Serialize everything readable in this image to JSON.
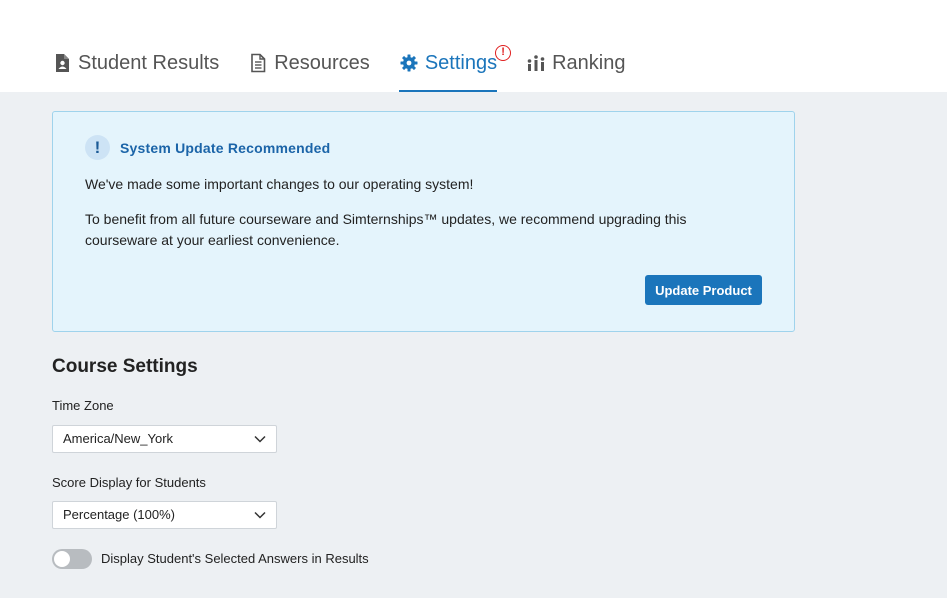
{
  "tabs": [
    {
      "label": "Student Results",
      "icon": "document-person-icon"
    },
    {
      "label": "Resources",
      "icon": "document-lines-icon"
    },
    {
      "label": "Settings",
      "icon": "gear-icon",
      "active": true,
      "badge": "!"
    },
    {
      "label": "Ranking",
      "icon": "ranking-icon"
    }
  ],
  "notice": {
    "icon_text": "!",
    "title": "System Update Recommended",
    "line1": "We've made some important changes to our operating system!",
    "line2": "To benefit from all future courseware and Simternships™ updates, we recommend upgrading this courseware at your earliest convenience.",
    "button": "Update Product"
  },
  "course_settings": {
    "title": "Course Settings",
    "time_zone_label": "Time Zone",
    "time_zone_value": "America/New_York",
    "score_label": "Score Display for Students",
    "score_value": "Percentage (100%)",
    "toggle_label": "Display Student's Selected Answers in Results",
    "toggle_on": false
  },
  "colors": {
    "accent": "#1b75bb",
    "badge": "#e02020",
    "notice_bg": "#e4f4fc",
    "page_bg": "#edf0f3"
  }
}
